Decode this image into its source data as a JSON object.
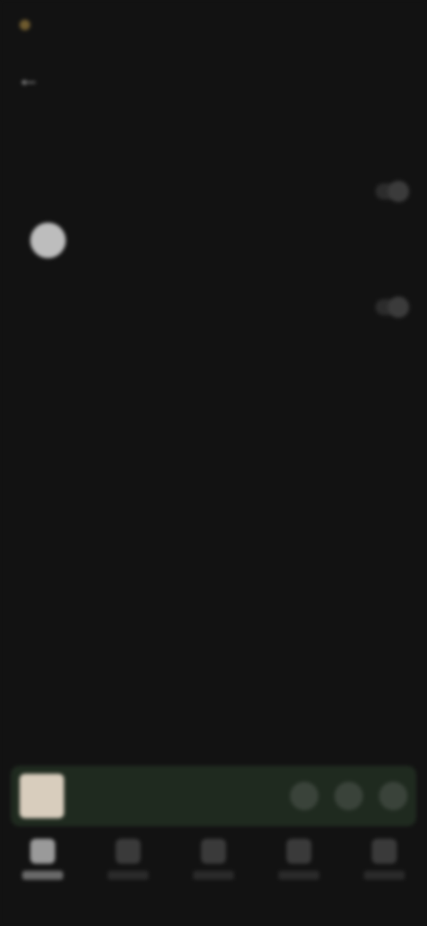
{
  "status_bar": {
    "time": "",
    "indicators": ""
  },
  "app_bar": {
    "back_icon": "back-arrow-icon",
    "title": ""
  },
  "settings": {
    "section_title": "",
    "row_1": {
      "title": "",
      "subtitle": ""
    },
    "row_2": {
      "title": "",
      "subtitle": ""
    },
    "subsection_title": "",
    "user": {
      "name": ""
    },
    "row_3": {
      "title": "",
      "subtitle": ""
    },
    "footnote": ""
  },
  "mini_player": {
    "track": ""
  },
  "bottom_nav": {
    "items": [
      "",
      "",
      "",
      "",
      ""
    ]
  }
}
